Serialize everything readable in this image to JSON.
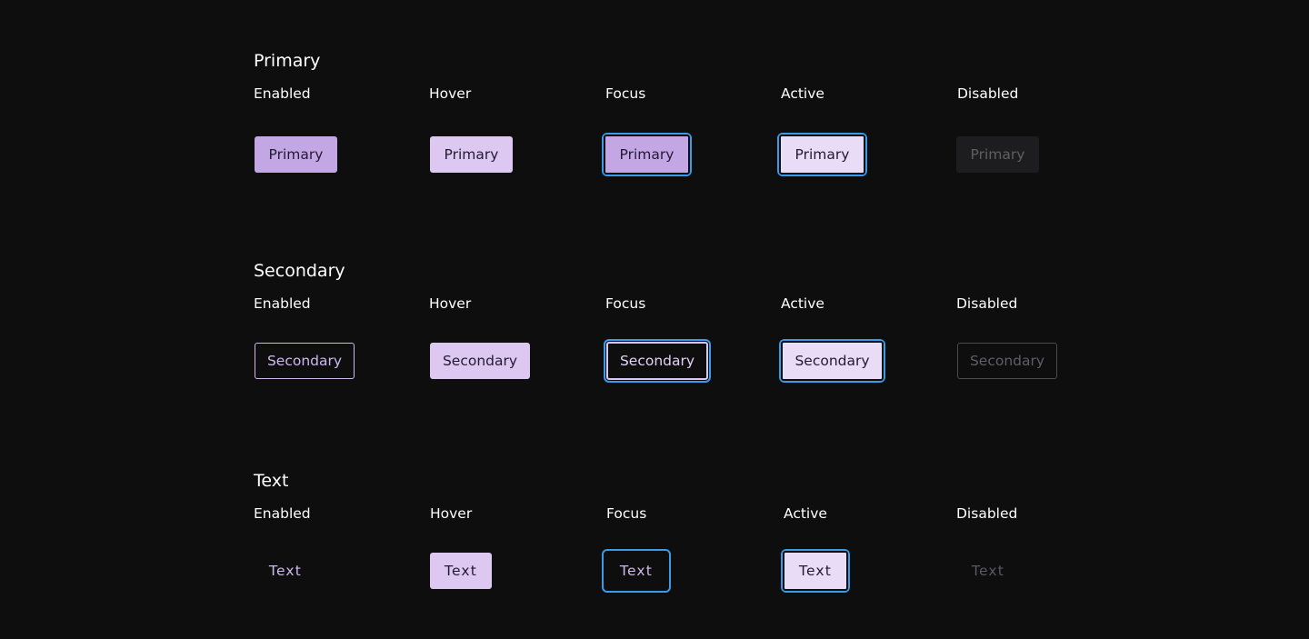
{
  "sections": {
    "primary": {
      "title": "Primary",
      "states": [
        "Enabled",
        "Hover",
        "Focus",
        "Active",
        "Disabled"
      ],
      "button_label": "Primary"
    },
    "secondary": {
      "title": "Secondary",
      "states": [
        "Enabled",
        "Hover",
        "Focus",
        "Active",
        "Disabled"
      ],
      "button_label": "Secondary"
    },
    "text": {
      "title": "Text",
      "states": [
        "Enabled",
        "Hover",
        "Focus",
        "Active",
        "Disabled"
      ],
      "button_label": "Text"
    }
  },
  "colors": {
    "background": "#0e0e0f",
    "primary_fill": "#c3a6e4",
    "hover_fill": "#dcc8f0",
    "active_fill": "#e8dcf6",
    "focus_ring": "#3c9be8",
    "disabled_fill": "#1d1d1f",
    "disabled_text": "#5f5f63"
  }
}
